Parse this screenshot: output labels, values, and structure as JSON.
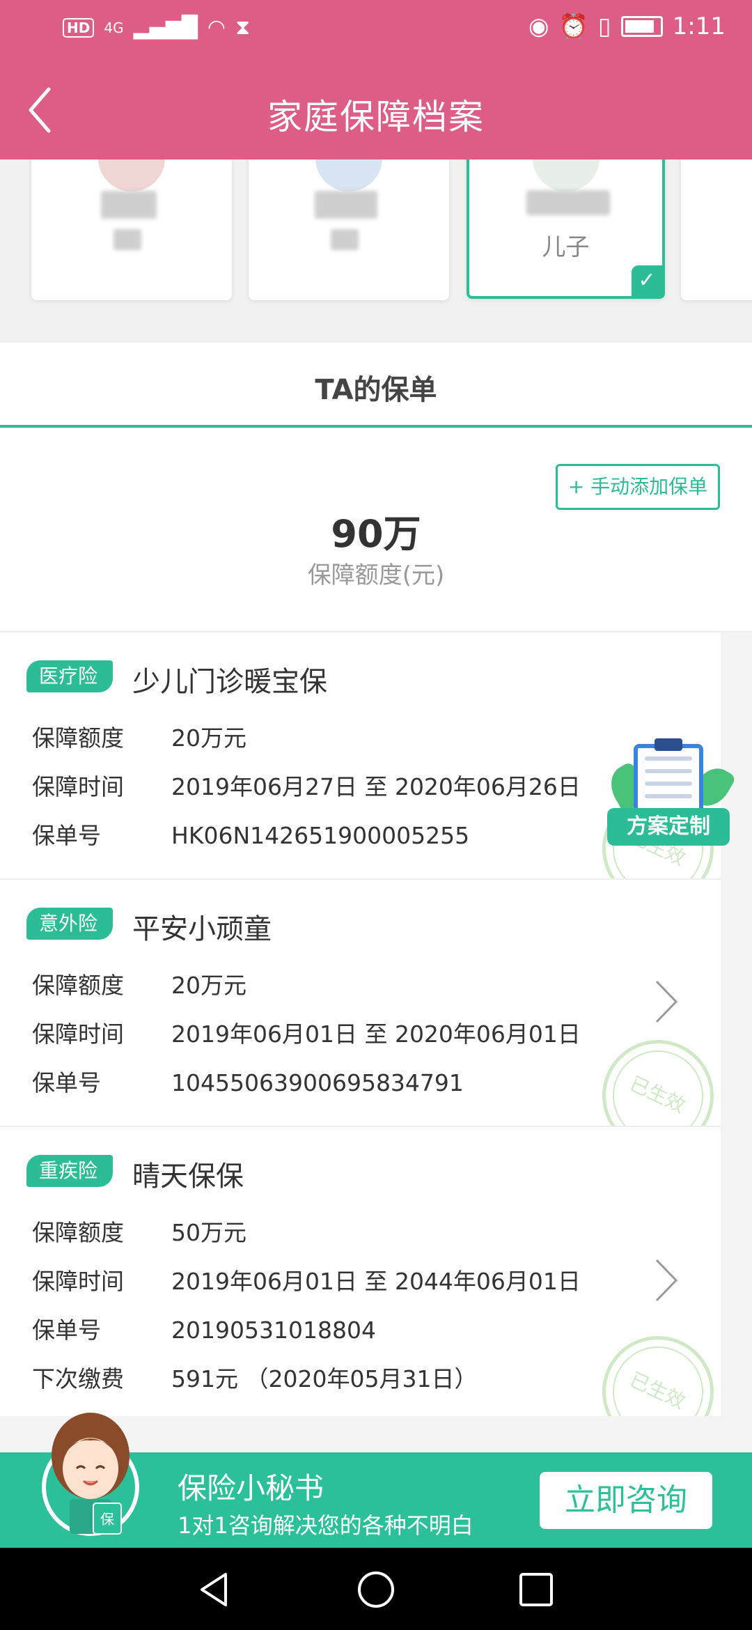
{
  "status_bar": {
    "network": "4G",
    "hd": "HD",
    "time": "1:11"
  },
  "header": {
    "title": "家庭保障档案"
  },
  "members": [
    {
      "relation": ""
    },
    {
      "relation": ""
    },
    {
      "relation": "儿子",
      "selected": true
    },
    {
      "relation": ""
    }
  ],
  "section": {
    "title": "TA的保单"
  },
  "summary": {
    "add_label": "+ 手动添加保单",
    "total": "90万",
    "total_label": "保障额度(元)"
  },
  "labels": {
    "coverage": "保障额度",
    "period": "保障时间",
    "number": "保单号",
    "next_payment": "下次缴费",
    "effective": "已生效"
  },
  "policies": [
    {
      "type": "医疗险",
      "name": "少儿门诊暖宝保",
      "coverage": "20万元",
      "period": "2019年06月27日 至 2020年06月26日",
      "number": "HK06N142651900005255"
    },
    {
      "type": "意外险",
      "name": "平安小顽童",
      "coverage": "20万元",
      "period": "2019年06月01日 至 2020年06月01日",
      "number": "10455063900695834791"
    },
    {
      "type": "重疾险",
      "name": "晴天保保",
      "coverage": "50万元",
      "period": "2019年06月01日 至 2044年06月01日",
      "number": "20190531018804",
      "next_payment": "591元 （2020年05月31日）"
    }
  ],
  "plan_widget": {
    "label": "方案定制"
  },
  "consult": {
    "title": "保险小秘书",
    "subtitle": "1对1咨询解决您的各种不明白",
    "button": "立即咨询",
    "badge": "保"
  },
  "colors": {
    "header": "#dd5d86",
    "accent": "#2dbd96",
    "consult": "#2cc09a"
  }
}
